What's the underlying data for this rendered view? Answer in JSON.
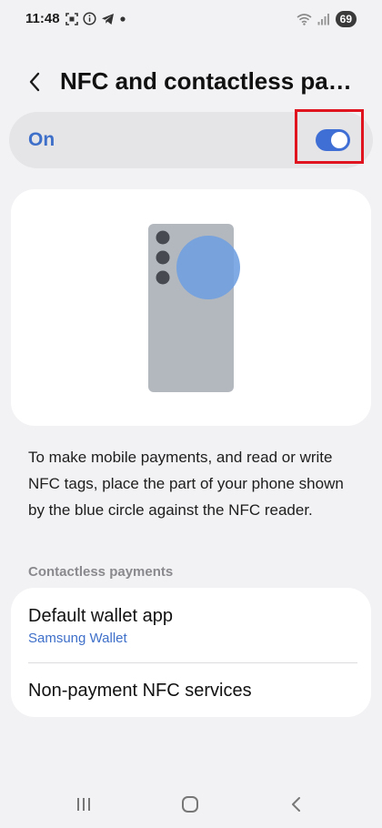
{
  "status_bar": {
    "time": "11:48",
    "left_icons": [
      "screenshot-icon",
      "info-icon",
      "telegram-icon",
      "dot-icon"
    ],
    "right_icons": [
      "wifi-icon",
      "signal-icon"
    ],
    "battery": "69"
  },
  "header": {
    "title": "NFC and contactless payments"
  },
  "master_toggle": {
    "label": "On",
    "state": "on",
    "accent_color": "#3f6fd4"
  },
  "illustration": {
    "phone_color": "#b3b8bf",
    "circle_color": "#6e9ee0"
  },
  "description": "To make mobile payments, and read or write NFC tags, place the part of your phone shown by the blue circle against the NFC reader.",
  "contactless_payments": {
    "section_title": "Contactless payments",
    "items": [
      {
        "title": "Default wallet app",
        "subtitle": "Samsung Wallet"
      },
      {
        "title": "Non-payment NFC services"
      }
    ]
  },
  "nav_bar": {
    "buttons": [
      "recents-icon",
      "home-icon",
      "back-icon"
    ]
  }
}
